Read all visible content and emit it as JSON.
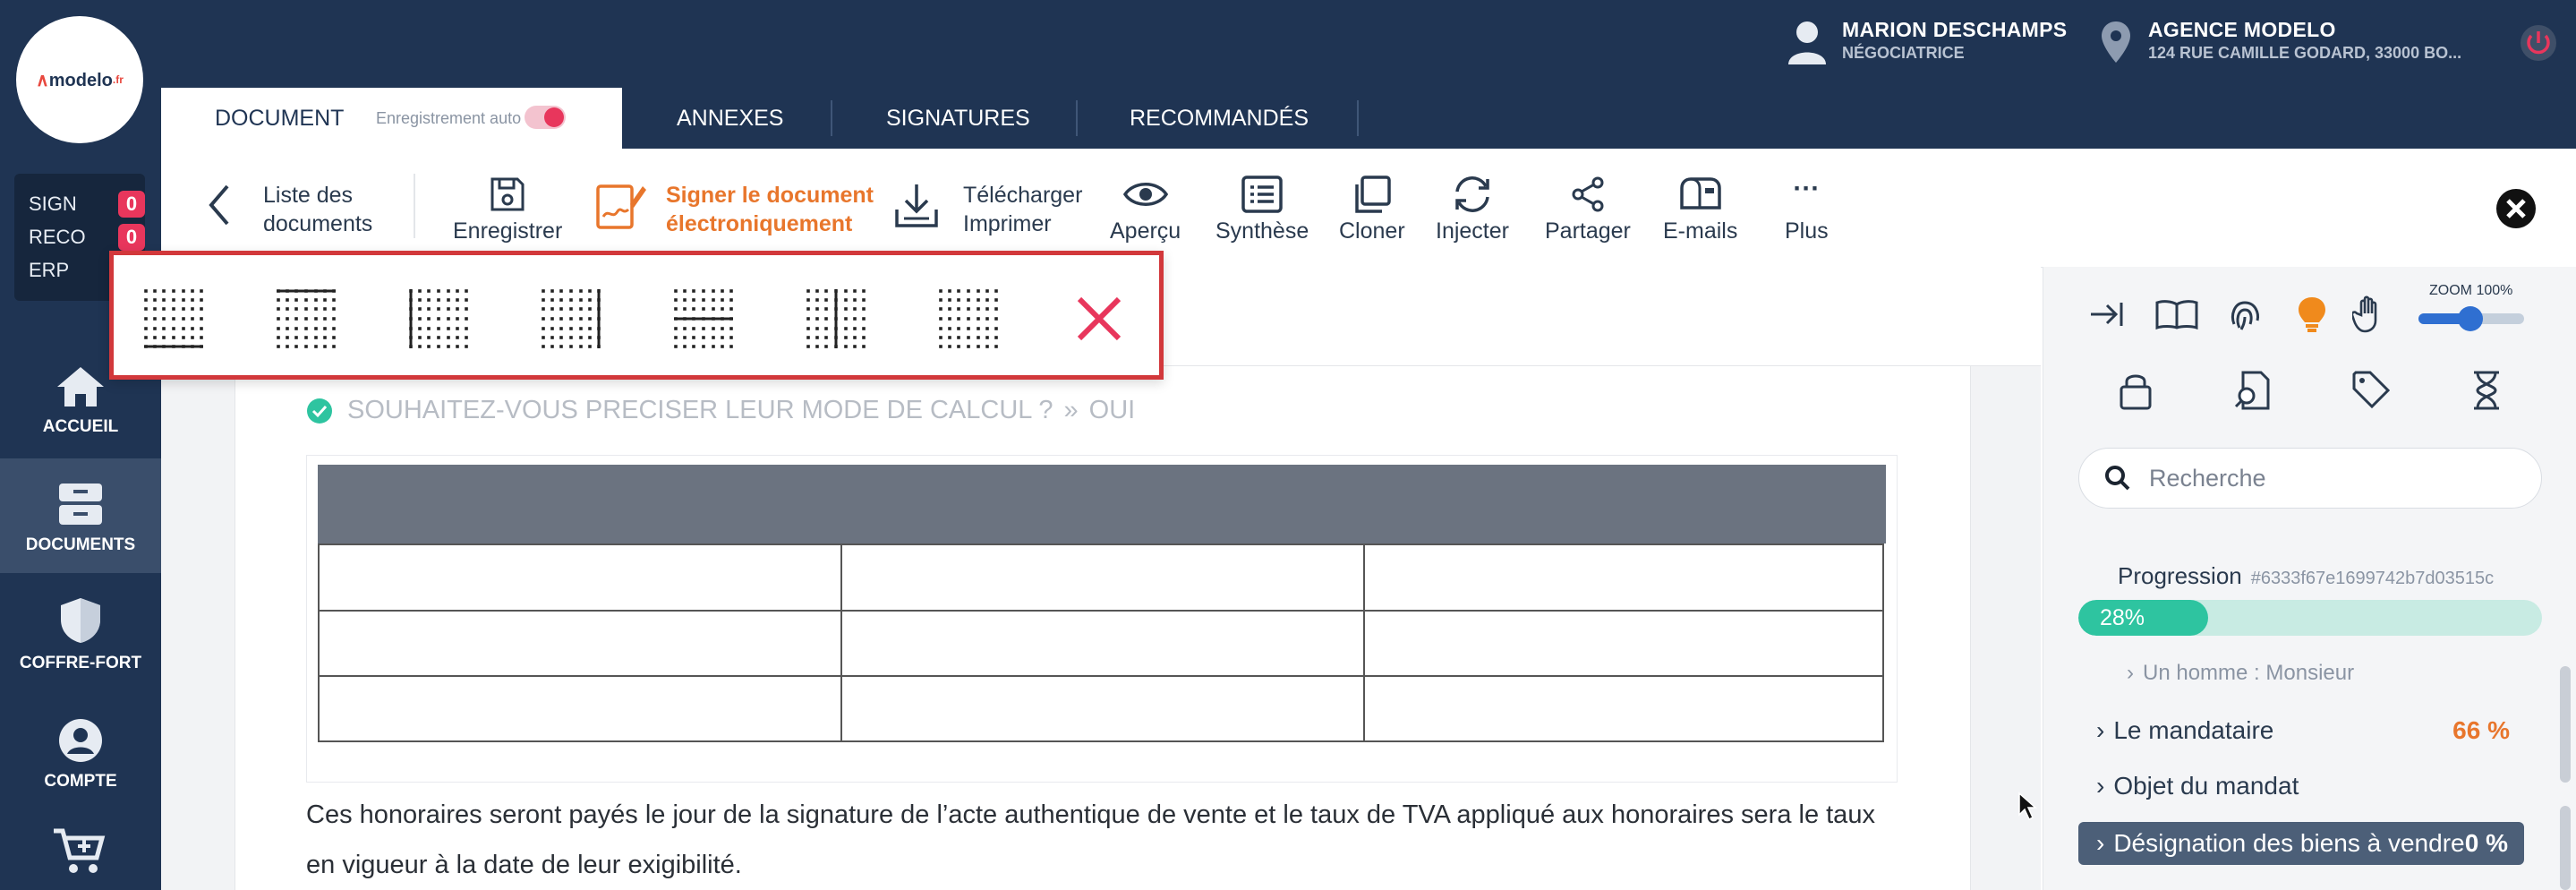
{
  "app": {
    "logo_text": "modelo",
    "logo_suffix": ".fr"
  },
  "counters": [
    {
      "label": "SIGN",
      "value": "0"
    },
    {
      "label": "RECO",
      "value": "0"
    },
    {
      "label": "ERP",
      "value": ""
    }
  ],
  "sidebar": {
    "items": [
      {
        "label": "ACCUEIL",
        "icon": "home-icon"
      },
      {
        "label": "DOCUMENTS",
        "icon": "documents-icon",
        "active": true
      },
      {
        "label": "COFFRE-FORT",
        "icon": "shield-icon"
      },
      {
        "label": "COMPTE",
        "icon": "user-icon"
      },
      {
        "label": "",
        "icon": "cart-icon"
      }
    ]
  },
  "user": {
    "name": "MARION DESCHAMPS",
    "role": "NÉGOCIATRICE"
  },
  "agency": {
    "name": "AGENCE MODELO",
    "address": "124 RUE CAMILLE GODARD, 33000 BO..."
  },
  "tabs": {
    "document": "DOCUMENT",
    "autosave_label": "Enregistrement auto",
    "annexes": "ANNEXES",
    "signatures": "SIGNATURES",
    "recommandes": "RECOMMANDÉS"
  },
  "toolbar": {
    "back_line1": "Liste des",
    "back_line2": "documents",
    "save": "Enregistrer",
    "sign_line1": "Signer le document",
    "sign_line2": "électroniquement",
    "download_line1": "Télécharger",
    "download_line2": "Imprimer",
    "preview": "Aperçu",
    "summary": "Synthèse",
    "clone": "Cloner",
    "inject": "Injecter",
    "share": "Partager",
    "emails": "E-mails",
    "more_dots": "···",
    "more": "Plus"
  },
  "document": {
    "question": "SOUHAITEZ-VOUS PRECISER LEUR MODE DE CALCUL ?",
    "answer": "OUI",
    "paragraph_line1": "Ces honoraires seront payés le jour de la signature de l’acte authentique de vente et le taux de TVA appliqué aux honoraires sera le taux",
    "paragraph_line2": "en vigueur à la date de leur exigibilité."
  },
  "right_panel": {
    "zoom_label": "ZOOM 100%",
    "zoom_value": 100,
    "search_placeholder": "Recherche",
    "progress_label": "Progression",
    "progress_id": "#6333f67e1699742b7d03515c",
    "progress_value": "28%",
    "progress_fraction": 0.28,
    "tree": [
      {
        "label": "Un homme : Monsieur",
        "percent": ""
      },
      {
        "label": "Le mandataire",
        "percent": "66 %"
      },
      {
        "label": "Objet du mandat",
        "percent": ""
      },
      {
        "label": "Désignation des biens à vendre",
        "percent": "0 %"
      }
    ]
  },
  "colors": {
    "navy": "#1f3453",
    "accent_orange": "#e8762c",
    "badge_pink": "#e8365c",
    "progress_green": "#2ec4a0",
    "popup_red": "#d2383b"
  }
}
